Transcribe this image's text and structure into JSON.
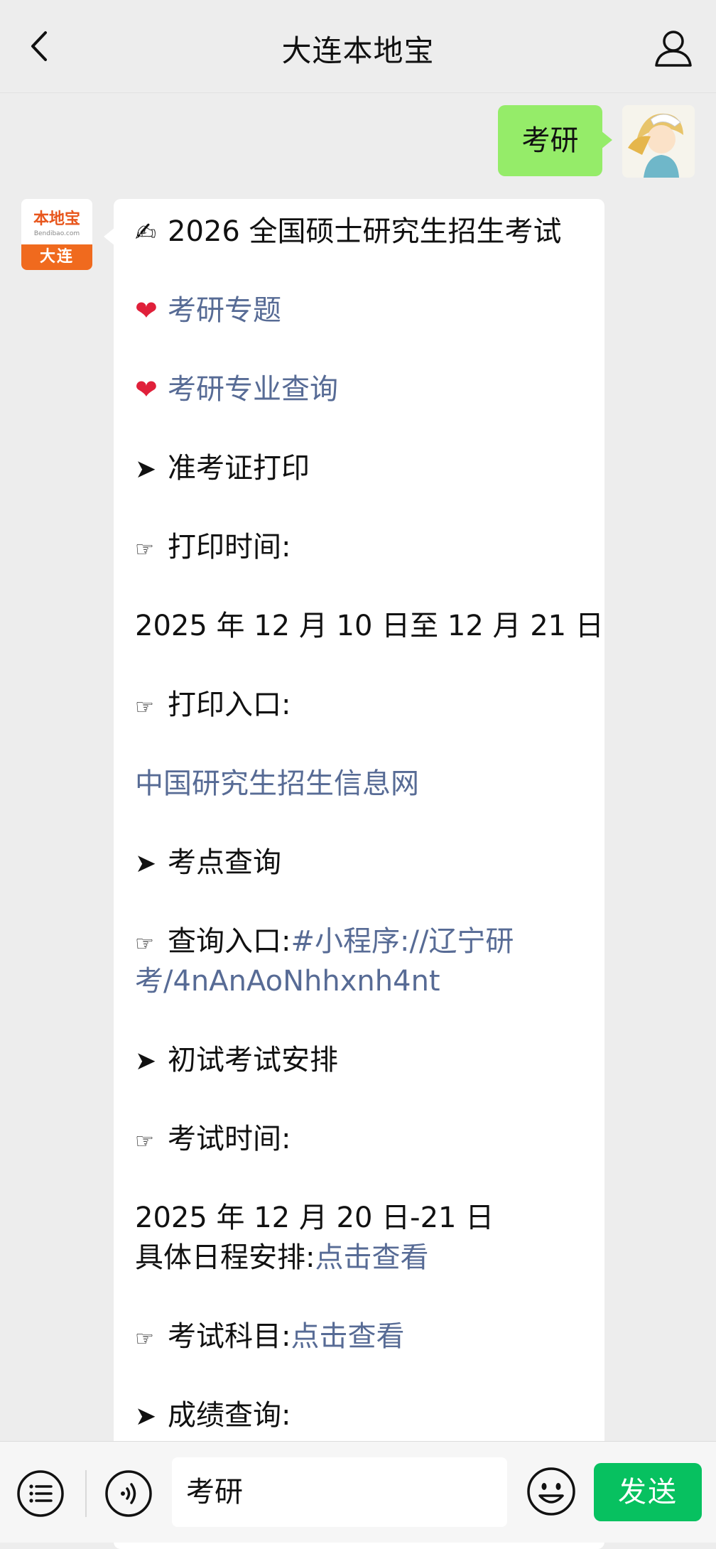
{
  "header": {
    "title": "大连本地宝",
    "back_icon": "chevron-left-icon",
    "profile_icon": "person-icon"
  },
  "outgoing": {
    "text": "考研"
  },
  "bot": {
    "logo_text": "本地宝",
    "logo_sub": "Bendibao.com",
    "logo_city": "大连"
  },
  "message": {
    "title_icon": "✍",
    "title": "2026 全国硕士研究生招生考试",
    "heart_icon": "❤",
    "special": "考研专题",
    "major_query": "考研专业查询",
    "arrow_icon": "➤",
    "point_icon": "☞",
    "admission": "准考证打印",
    "print_time_label": "打印时间:",
    "print_time": "2025 年 12 月 10 日至 12 月 21 日",
    "print_entry_label": "打印入口:",
    "print_entry_link": "中国研究生招生信息网",
    "site_query": "考点查询",
    "query_entry_label": "查询入口:",
    "query_entry_link_1": "#小程序://辽宁研",
    "query_entry_link_2": "考/4nAnAoNhhxnh4nt",
    "schedule": "初试考试安排",
    "exam_time_label": "考试时间:",
    "exam_time": "2025 年 12 月 20 日-21 日",
    "detail_label": "具体日程安排:",
    "detail_link": "点击查看",
    "subjects_label": "考试科目:",
    "subjects_link": "点击查看",
    "score_query": "成绩查询:"
  },
  "bottom": {
    "input_value": "考研",
    "send_label": "发送",
    "menu_icon": "list-icon",
    "voice_icon": "voice-icon",
    "emoji_icon": "smiley-icon"
  },
  "colors": {
    "bubble_out": "#95ec69",
    "link": "#576b95",
    "send": "#07c160",
    "background": "#ededed"
  }
}
